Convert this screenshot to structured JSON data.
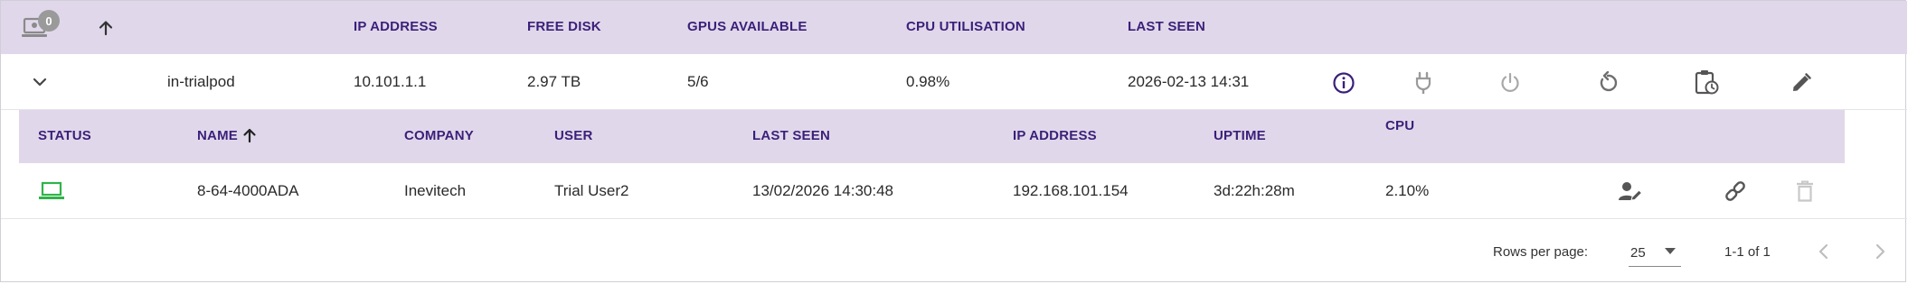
{
  "outer_header": {
    "notification_count": "0",
    "columns": {
      "ip": "IP ADDRESS",
      "disk": "FREE DISK",
      "gpus": "GPUS AVAILABLE",
      "cpu": "CPU UTILISATION",
      "last_seen": "LAST SEEN"
    }
  },
  "pod_row": {
    "name": "in-trialpod",
    "ip": "10.101.1.1",
    "disk": "2.97 TB",
    "gpus": "5/6",
    "cpu": "0.98%",
    "last_seen": "2026-02-13 14:31",
    "actions": [
      "info-icon",
      "plug-icon",
      "power-icon",
      "restart-icon",
      "schedule-clipboard-icon",
      "edit-icon"
    ]
  },
  "inner_header": {
    "status": "STATUS",
    "name": "NAME",
    "company": "COMPANY",
    "user": "USER",
    "last_seen": "LAST SEEN",
    "ip": "IP ADDRESS",
    "uptime": "UPTIME",
    "cpu": "CPU"
  },
  "device_row": {
    "status_icon": "laptop-icon",
    "name": "8-64-4000ADA",
    "company": "Inevitech",
    "user": "Trial User2",
    "last_seen": "13/02/2026 14:30:48",
    "ip": "192.168.101.154",
    "uptime": "3d:22h:28m",
    "cpu": "2.10%",
    "actions": [
      "assign-user-icon",
      "link-icon",
      "delete-icon"
    ]
  },
  "pagination": {
    "rows_per_page_label": "Rows per page:",
    "rows_per_page_value": "25",
    "range": "1-1 of 1"
  },
  "colors": {
    "header_bg": "#e0d8ea",
    "header_text": "#3b1f7a",
    "status_online": "#2fb34a",
    "icon_gray": "#8a8a8a"
  }
}
